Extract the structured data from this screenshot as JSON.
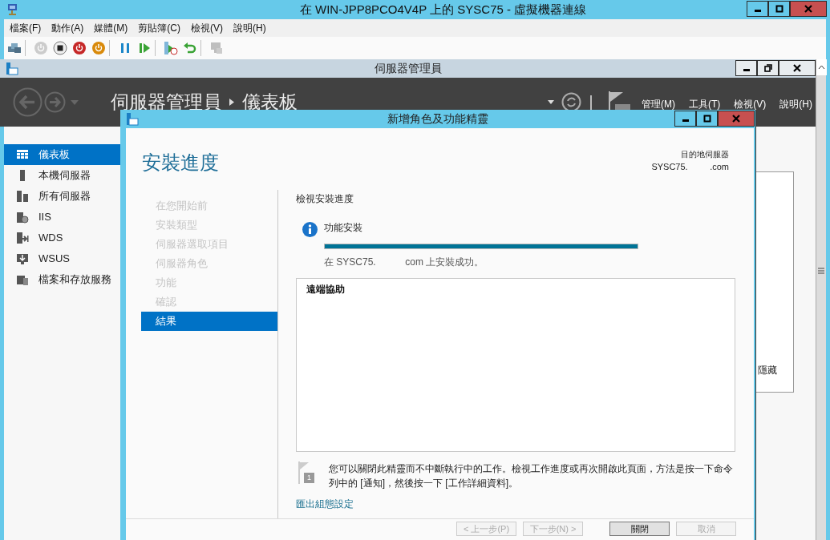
{
  "vm_window": {
    "title": "在 WIN-JPP8PCO4V4P 上的 SYSC75 - 虛擬機器連線"
  },
  "menu_bar": [
    "檔案(F)",
    "動作(A)",
    "媒體(M)",
    "剪貼簿(C)",
    "檢視(V)",
    "說明(H)"
  ],
  "toolbar": [
    [
      {
        "kind": "ctrl_alt_del",
        "disabled": false
      }
    ],
    [
      {
        "kind": "start",
        "disabled": true
      },
      {
        "kind": "turn_off",
        "disabled": false
      },
      {
        "kind": "shut_down",
        "disabled": false
      },
      {
        "kind": "save",
        "disabled": false
      }
    ],
    [
      {
        "kind": "pause",
        "disabled": false
      },
      {
        "kind": "resume",
        "disabled": false
      }
    ],
    [
      {
        "kind": "checkpoint",
        "disabled": false
      },
      {
        "kind": "revert",
        "disabled": false
      }
    ],
    [
      {
        "kind": "enhanced",
        "disabled": true
      }
    ]
  ],
  "server_manager": {
    "title": "伺服器管理員",
    "breadcrumb": [
      "伺服器管理員",
      "儀表板"
    ],
    "menus": [
      "管理(M)",
      "工具(T)",
      "檢視(V)",
      "說明(H)"
    ],
    "sidebar": [
      {
        "label": "儀表板",
        "kind": "dashboard",
        "selected": true
      },
      {
        "label": "本機伺服器",
        "kind": "local_server",
        "selected": false
      },
      {
        "label": "所有伺服器",
        "kind": "all_servers",
        "selected": false
      },
      {
        "label": "IIS",
        "kind": "iis",
        "selected": false
      },
      {
        "label": "WDS",
        "kind": "wds",
        "selected": false
      },
      {
        "label": "WSUS",
        "kind": "wsus",
        "selected": false
      },
      {
        "label": "檔案和存放服務",
        "kind": "file_storage",
        "selected": false
      }
    ],
    "panel_text": "隱藏"
  },
  "wizard": {
    "title": "新增角色及功能精靈",
    "heading": "安裝進度",
    "destination_label": "目的地伺服器",
    "destination_server": "SYSC75.         .com",
    "steps": [
      {
        "label": "在您開始前",
        "selected": false
      },
      {
        "label": "安裝類型",
        "selected": false
      },
      {
        "label": "伺服器選取項目",
        "selected": false
      },
      {
        "label": "伺服器角色",
        "selected": false
      },
      {
        "label": "功能",
        "selected": false
      },
      {
        "label": "確認",
        "selected": false
      },
      {
        "label": "結果",
        "selected": true
      }
    ],
    "section_title": "檢視安裝進度",
    "task": {
      "title": "功能安裝",
      "level": 1,
      "status": "在 SYSC75.           com 上安裝成功。"
    },
    "results": [
      "遠端協助"
    ],
    "note": "您可以關閉此精靈而不中斷執行中的工作。檢視工作進度或再次開啟此頁面，方法是按一下命令列中的 [通知]，然後按一下 [工作詳細資料]。",
    "note_badge": "1",
    "export_link": "匯出組態設定",
    "buttons": [
      {
        "label": "< 上一步(P)",
        "disabled": true
      },
      {
        "label": "下一步(N) >",
        "disabled": true
      },
      {
        "label": "關閉",
        "disabled": false
      },
      {
        "label": "取消",
        "disabled": true
      }
    ]
  }
}
